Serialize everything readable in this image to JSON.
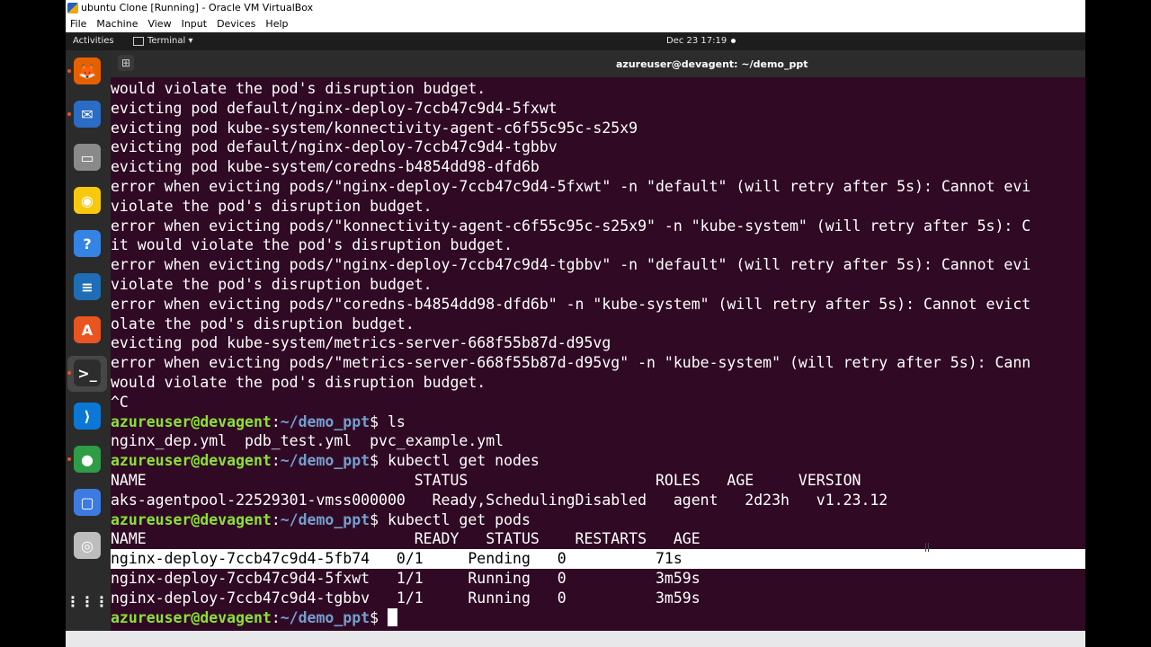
{
  "window": {
    "title": "ubuntu Clone [Running] - Oracle VM VirtualBox"
  },
  "menu": [
    "File",
    "Machine",
    "View",
    "Input",
    "Devices",
    "Help"
  ],
  "topbar": {
    "activities": "Activities",
    "app": "Terminal ▾",
    "clock": "Dec 23  17:19"
  },
  "dock": [
    {
      "icon": "firefox-icon",
      "glyph": "🦊",
      "color": "#e66000"
    },
    {
      "icon": "thunderbird-icon",
      "glyph": "✉",
      "color": "#2a6cc6"
    },
    {
      "icon": "files-icon",
      "glyph": "▭",
      "color": "#8a8a8a"
    },
    {
      "icon": "rhythmbox-icon",
      "glyph": "◉",
      "color": "#f6c90e"
    },
    {
      "icon": "help-icon",
      "glyph": "?",
      "color": "#3584e4"
    },
    {
      "icon": "writer-icon",
      "glyph": "≡",
      "color": "#1e6db6"
    },
    {
      "icon": "software-icon",
      "glyph": "A",
      "color": "#e95420"
    },
    {
      "icon": "terminal-icon",
      "glyph": ">_",
      "color": "#2d2d2d"
    },
    {
      "icon": "vscode-icon",
      "glyph": "⟩",
      "color": "#0a78d4"
    },
    {
      "icon": "chrome-icon",
      "glyph": "●",
      "color": "#2e9d46"
    },
    {
      "icon": "screenshot-icon",
      "glyph": "▢",
      "color": "#3d7be0"
    },
    {
      "icon": "disc-icon",
      "glyph": "◎",
      "color": "#bdbdbd"
    },
    {
      "icon": "app-grid-icon",
      "glyph": "⋮⋮⋮",
      "color": "#2b2b2b"
    }
  ],
  "terminal": {
    "title": "azureuser@devagent: ~/demo_ppt",
    "user_host": "azureuser@devagent",
    "path": "~/demo_ppt",
    "prompt_suffix": "$ ",
    "lines": [
      {
        "text": "would violate the pod's disruption budget."
      },
      {
        "text": "evicting pod default/nginx-deploy-7ccb47c9d4-5fxwt"
      },
      {
        "text": "evicting pod kube-system/konnectivity-agent-c6f55c95c-s25x9"
      },
      {
        "text": "evicting pod default/nginx-deploy-7ccb47c9d4-tgbbv"
      },
      {
        "text": "evicting pod kube-system/coredns-b4854dd98-dfd6b"
      },
      {
        "text": "error when evicting pods/\"nginx-deploy-7ccb47c9d4-5fxwt\" -n \"default\" (will retry after 5s): Cannot evi"
      },
      {
        "text": "violate the pod's disruption budget."
      },
      {
        "text": "error when evicting pods/\"konnectivity-agent-c6f55c95c-s25x9\" -n \"kube-system\" (will retry after 5s): C"
      },
      {
        "text": "it would violate the pod's disruption budget."
      },
      {
        "text": "error when evicting pods/\"nginx-deploy-7ccb47c9d4-tgbbv\" -n \"default\" (will retry after 5s): Cannot evi"
      },
      {
        "text": "violate the pod's disruption budget."
      },
      {
        "text": "error when evicting pods/\"coredns-b4854dd98-dfd6b\" -n \"kube-system\" (will retry after 5s): Cannot evict"
      },
      {
        "text": "olate the pod's disruption budget."
      },
      {
        "text": "evicting pod kube-system/metrics-server-668f55b87d-d95vg"
      },
      {
        "text": "error when evicting pods/\"metrics-server-668f55b87d-d95vg\" -n \"kube-system\" (will retry after 5s): Cann"
      },
      {
        "text": "would violate the pod's disruption budget."
      },
      {
        "text": "^C"
      },
      {
        "prompt": true,
        "cmd": "ls"
      },
      {
        "text": "nginx_dep.yml  pdb_test.yml  pvc_example.yml"
      },
      {
        "prompt": true,
        "cmd": "kubectl get nodes"
      },
      {
        "text": "NAME                              STATUS                     ROLES   AGE     VERSION"
      },
      {
        "text": "aks-agentpool-22529301-vmss000000   Ready,SchedulingDisabled   agent   2d23h   v1.23.12"
      },
      {
        "prompt": true,
        "cmd": "kubectl get pods"
      },
      {
        "text": "NAME                              READY   STATUS    RESTARTS   AGE"
      },
      {
        "text": "nginx-deploy-7ccb47c9d4-5fb74   0/1     Pending   0          71s",
        "highlight": true
      },
      {
        "text": "nginx-deploy-7ccb47c9d4-5fxwt   1/1     Running   0          3m59s"
      },
      {
        "text": "nginx-deploy-7ccb47c9d4-tgbbv   1/1     Running   0          3m59s"
      },
      {
        "prompt": true,
        "cmd": "",
        "cursor": true
      }
    ]
  }
}
